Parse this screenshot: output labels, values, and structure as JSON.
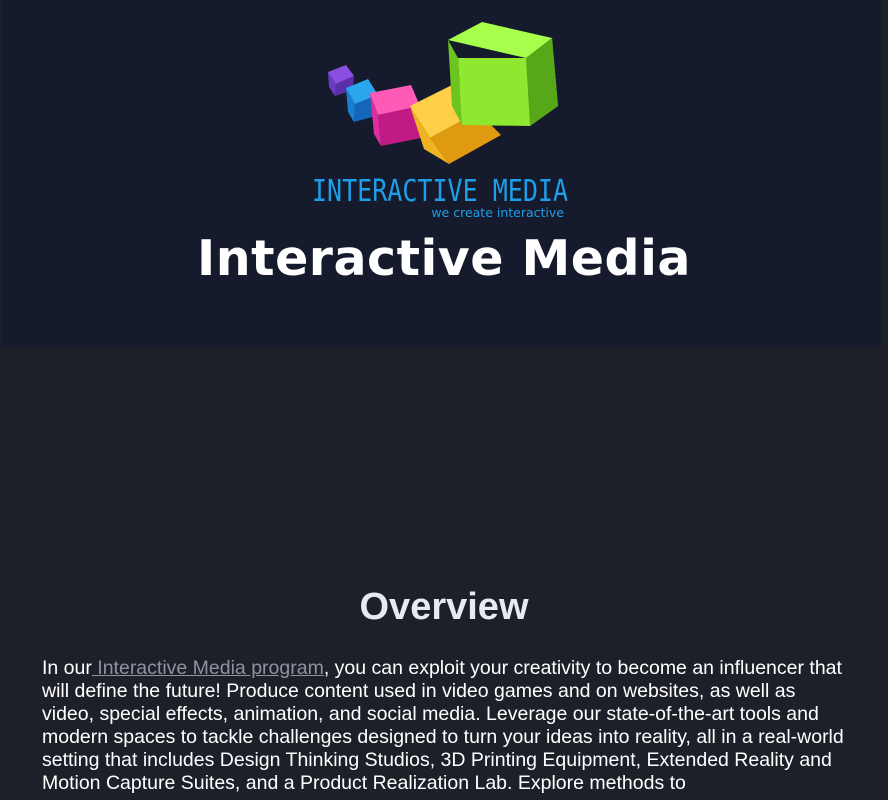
{
  "hero": {
    "logo_wordmark": "INTERACTIVE MEDIA",
    "logo_tagline": "we create interactive",
    "title": "Interactive Media",
    "colors": {
      "background": "#151a2d",
      "wordmark": "#1e9fe8"
    }
  },
  "overview": {
    "heading": "Overview",
    "intro_before_link": "In our",
    "link_text": " Interactive Media program",
    "intro_after_link": ", you can exploit your creativity to become an influencer that will define the future! Produce content used in video games and on websites, as well as video, special effects, animation, and social media. Leverage our state-of-the-art tools and modern spaces to tackle challenges designed to turn your ideas into reality, all in a real-world setting that includes Design Thinking Studios, 3D Printing Equipment, Extended Reality and Motion Capture Suites, and a Product Realization Lab. Explore methods to"
  },
  "colors": {
    "page_background": "#1d2028",
    "link": "#8f93a0",
    "heading": "#e7e9f3"
  }
}
